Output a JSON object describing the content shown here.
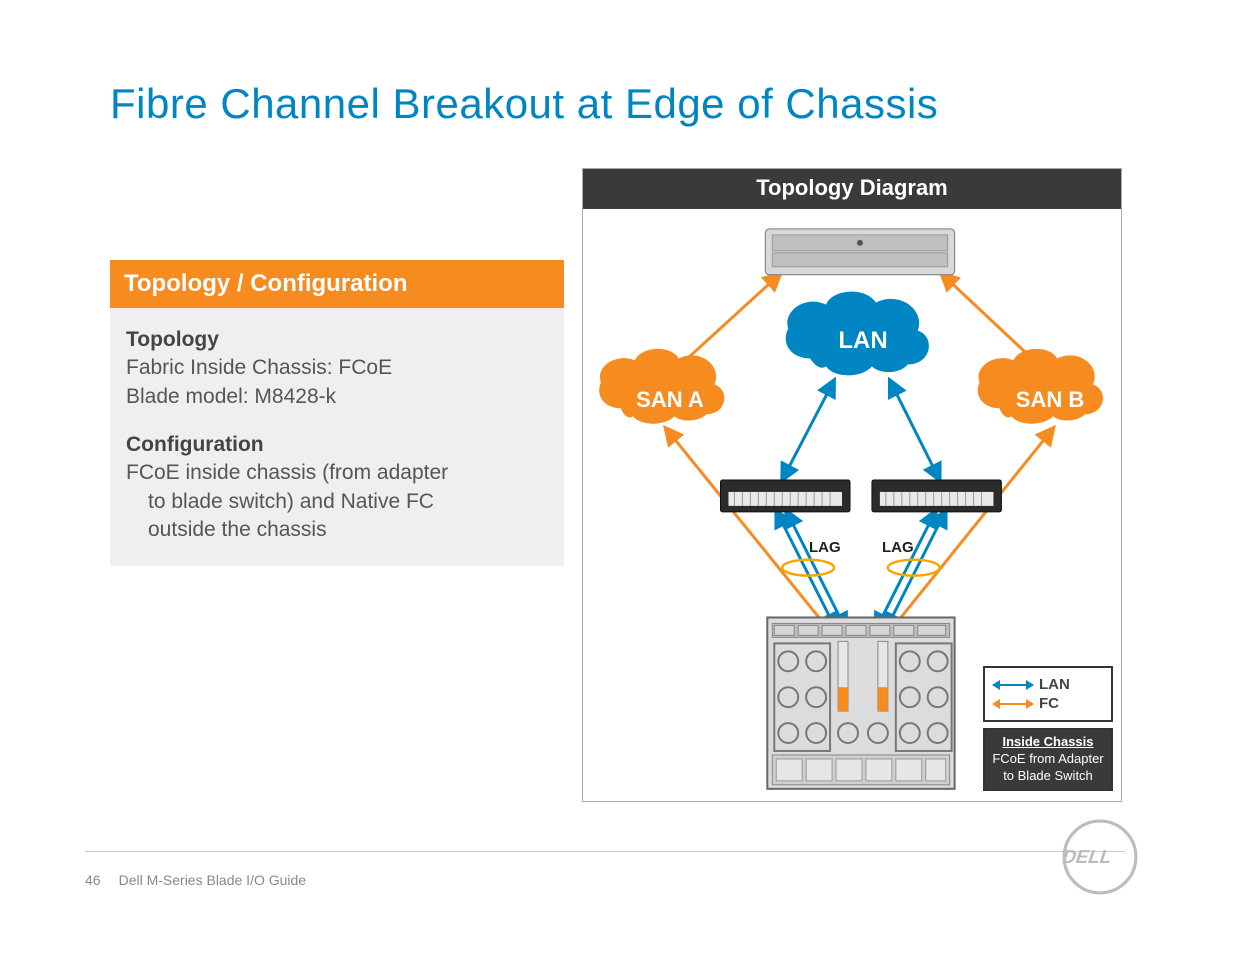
{
  "title": "Fibre Channel Breakout at Edge of Chassis",
  "panel": {
    "header": "Topology / Configuration",
    "topology": {
      "heading": "Topology",
      "line1": "Fabric Inside Chassis: FCoE",
      "line2": "Blade model: M8428-k"
    },
    "configuration": {
      "heading": "Configuration",
      "text_l1": "FCoE inside chassis (from adapter",
      "text_l2": "to blade switch) and Native FC",
      "text_l3": "outside the chassis"
    }
  },
  "diagram": {
    "header": "Topology Diagram",
    "nodes": {
      "storage": "storage-array",
      "lan_cloud": "LAN",
      "san_a": "SAN A",
      "san_b": "SAN B",
      "switch_left": "tor-switch-left",
      "switch_right": "tor-switch-right",
      "chassis": "blade-chassis"
    },
    "labels": {
      "lag_left": "LAG",
      "lag_right": "LAG"
    },
    "legend": {
      "lan": "LAN",
      "fc": "FC",
      "inside_title": "Inside Chassis",
      "inside_body": "FCoE from Adapter to Blade Switch"
    },
    "colors": {
      "fc": "#f68b1f",
      "lan": "#0085c3"
    }
  },
  "footer": {
    "page": "46",
    "doc": "Dell M-Series Blade I/O Guide",
    "brand": "DELL"
  }
}
